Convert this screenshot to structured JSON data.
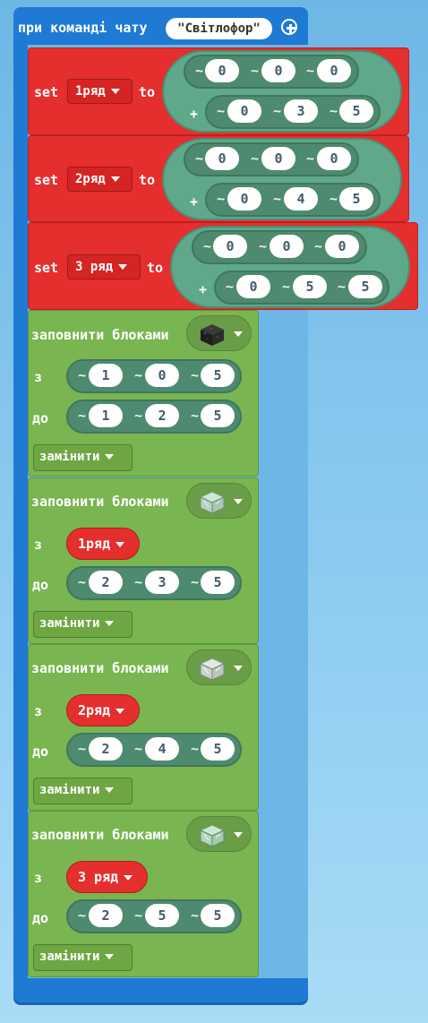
{
  "event": {
    "label": "при команді чату",
    "command_value": "\"Світлофор\"",
    "add_icon": "plus-circle-icon"
  },
  "set_blocks": [
    {
      "kw_set": "set",
      "variable": "1ряд",
      "kw_to": "to",
      "x": "0",
      "y": "0",
      "z": "0",
      "plus": "+",
      "dx": "0",
      "dy": "3",
      "dz": "5"
    },
    {
      "kw_set": "set",
      "variable": "2ряд",
      "kw_to": "to",
      "x": "0",
      "y": "0",
      "z": "0",
      "plus": "+",
      "dx": "0",
      "dy": "4",
      "dz": "5"
    },
    {
      "kw_set": "set",
      "variable": "3 ряд",
      "kw_to": "to",
      "x": "0",
      "y": "0",
      "z": "0",
      "plus": "+",
      "dx": "0",
      "dy": "5",
      "dz": "5"
    }
  ],
  "tilde": "~",
  "fill_blocks": [
    {
      "label": "заповнити блоками",
      "block_icon": "black-concrete-block-icon",
      "from_label": "з",
      "from_coords": [
        "1",
        "0",
        "5"
      ],
      "to_label": "до",
      "to_coords": [
        "1",
        "2",
        "5"
      ],
      "mode": "замінити"
    },
    {
      "label": "заповнити блоками",
      "block_icon": "glass-block-icon",
      "from_label": "з",
      "from_var": "1ряд",
      "to_label": "до",
      "to_coords": [
        "2",
        "3",
        "5"
      ],
      "mode": "замінити"
    },
    {
      "label": "заповнити блоками",
      "block_icon": "glass-block-icon",
      "from_label": "з",
      "from_var": "2ряд",
      "to_label": "до",
      "to_coords": [
        "2",
        "4",
        "5"
      ],
      "mode": "замінити"
    },
    {
      "label": "заповнити блоками",
      "block_icon": "glass-block-icon",
      "from_label": "з",
      "from_var": "3 ряд",
      "to_label": "до",
      "to_coords": [
        "2",
        "5",
        "5"
      ],
      "mode": "замінити"
    }
  ],
  "colors": {
    "event": "#1e7ad3",
    "variables": "#e52e2e",
    "positions": "#5fa88a",
    "blocks": "#79b550",
    "background": "#8ccbf0"
  }
}
